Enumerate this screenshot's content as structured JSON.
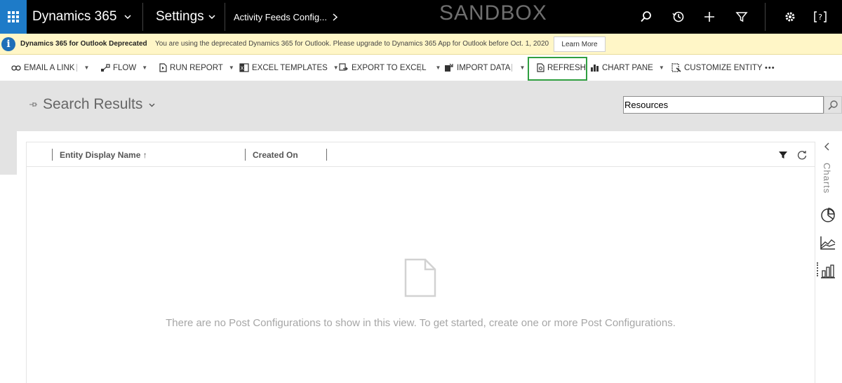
{
  "topbar": {
    "app_name": "Dynamics 365",
    "area_name": "Settings",
    "breadcrumb": "Activity Feeds Config...",
    "environment_label": "SANDBOX",
    "icons": [
      "search-icon",
      "history-icon",
      "plus-icon",
      "filter-icon",
      "gear-icon",
      "help-icon"
    ]
  },
  "message_bar": {
    "title": "Dynamics 365 for Outlook Deprecated",
    "text": "You are using the deprecated Dynamics 365 for Outlook. Please upgrade to Dynamics 365 App for Outlook before Oct. 1, 2020",
    "button": "Learn More"
  },
  "commands": {
    "email_link": "EMAIL A LINK",
    "flow": "FLOW",
    "run_report": "RUN REPORT",
    "excel_templates": "EXCEL TEMPLATES",
    "export_excel": "EXPORT TO EXCEL",
    "import_data": "IMPORT DATA",
    "refresh": "REFRESH",
    "chart_pane": "CHART PANE",
    "customize_entity": "CUSTOMIZE ENTITY",
    "more": "•••"
  },
  "view": {
    "title": "Search Results",
    "search_value": "Resources"
  },
  "grid": {
    "columns": [
      {
        "label": "Entity Display Name ↑"
      },
      {
        "label": "Created On"
      }
    ],
    "empty_message": "There are no Post Configurations to show in this view. To get started, create one or more Post Configurations."
  },
  "charts_pane": {
    "label": "Charts"
  },
  "colors": {
    "topbar": "#000000",
    "waffle": "#1e7bc8",
    "message_bar": "#fff6c7",
    "highlight": "#2f9f40",
    "gray_band": "#e3e3e3"
  }
}
